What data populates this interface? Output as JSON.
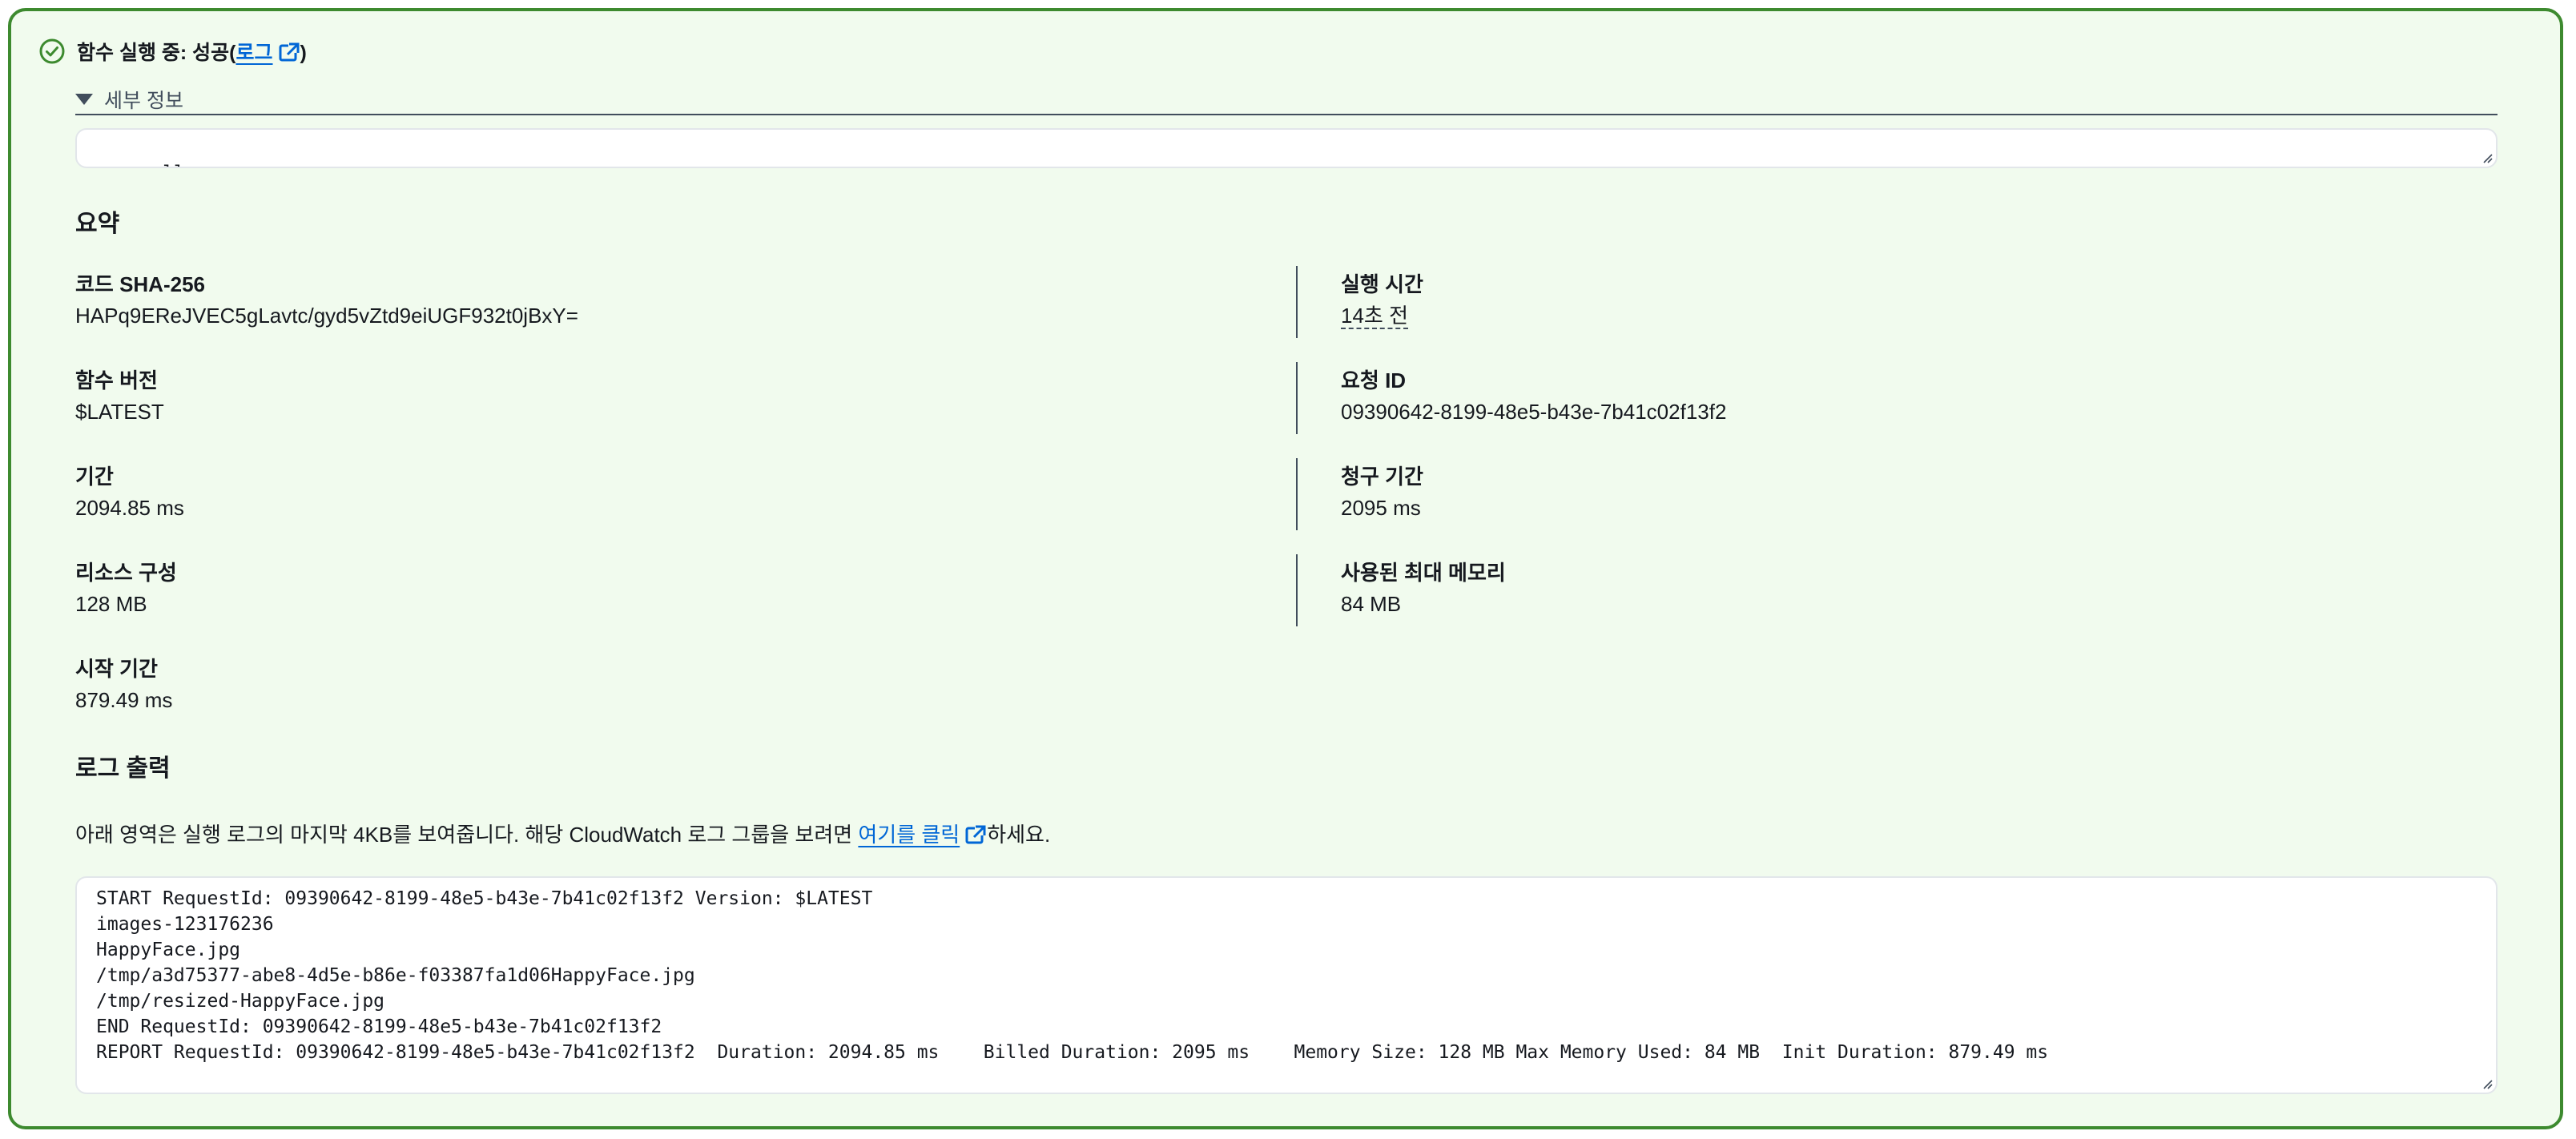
{
  "status": {
    "prefix": "함수 실행 중: 성공(",
    "log_link": "로그",
    "suffix": ")",
    "icon": "check-circle-icon",
    "accent_color": "#3d8a2f"
  },
  "details": {
    "toggle_label": "세부 정보",
    "output": "null"
  },
  "summary": {
    "heading": "요약",
    "left": [
      {
        "label": "코드 SHA-256",
        "value": "HAPq9EReJVEC5gLavtc/gyd5vZtd9eiUGF932t0jBxY="
      },
      {
        "label": "함수 버전",
        "value": "$LATEST"
      },
      {
        "label": "기간",
        "value": "2094.85 ms"
      },
      {
        "label": "리소스 구성",
        "value": "128 MB"
      },
      {
        "label": "시작 기간",
        "value": "879.49 ms"
      }
    ],
    "right": [
      {
        "label": "실행 시간",
        "value": "14초 전"
      },
      {
        "label": "요청 ID",
        "value": "09390642-8199-48e5-b43e-7b41c02f13f2"
      },
      {
        "label": "청구 기간",
        "value": "2095 ms"
      },
      {
        "label": "사용된 최대 메모리",
        "value": "84 MB"
      }
    ]
  },
  "log_output": {
    "heading": "로그 출력",
    "description_before": "아래 영역은 실행 로그의 마지막 4KB를 보여줍니다. 해당 CloudWatch 로그 그룹을 보려면 ",
    "link_text": "여기를 클릭",
    "description_after": "하세요.",
    "lines": [
      "START RequestId: 09390642-8199-48e5-b43e-7b41c02f13f2 Version: $LATEST",
      "images-123176236",
      "HappyFace.jpg",
      "/tmp/a3d75377-abe8-4d5e-b86e-f03387fa1d06HappyFace.jpg",
      "/tmp/resized-HappyFace.jpg",
      "END RequestId: 09390642-8199-48e5-b43e-7b41c02f13f2",
      "REPORT RequestId: 09390642-8199-48e5-b43e-7b41c02f13f2\tDuration: 2094.85 ms\tBilled Duration: 2095 ms\tMemory Size: 128 MB\tMax Memory Used: 84 MB\tInit Duration: 879.49 ms"
    ]
  }
}
